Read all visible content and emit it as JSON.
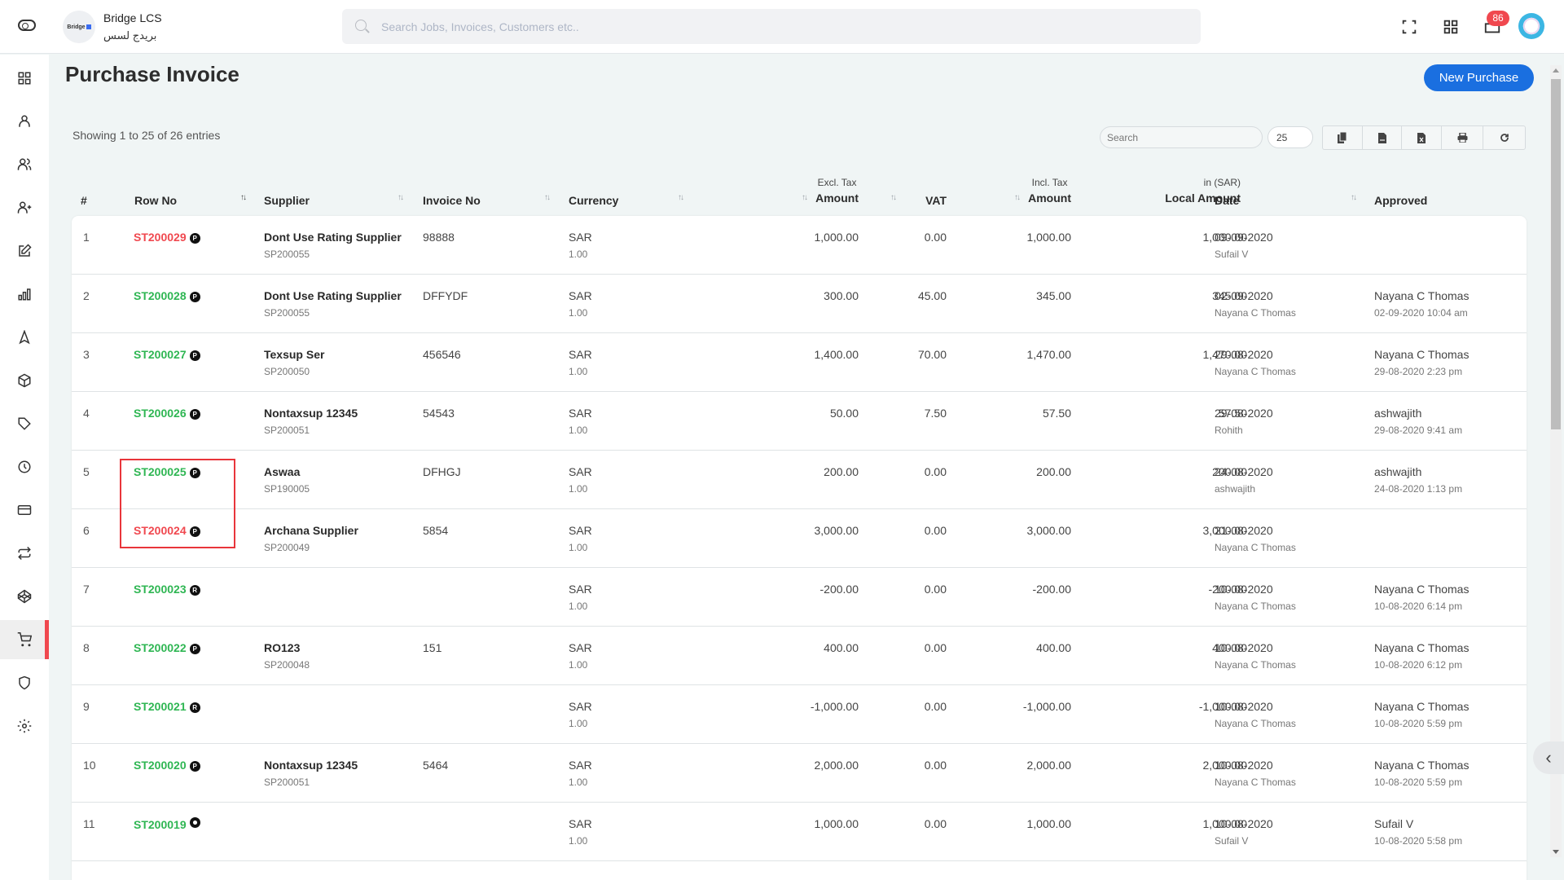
{
  "app": {
    "brand_name": "Bridge LCS",
    "brand_name_ar": "بريدج لسس",
    "logo_text": "Bridge",
    "search_placeholder": "Search Jobs, Invoices, Customers etc..",
    "notification_count": "86",
    "colors": {
      "accent": "#1a6fe0",
      "active": "#f0484f",
      "approved_green": "#2fb653",
      "pending_red": "#f0484f"
    }
  },
  "sidebar": {
    "items": [
      {
        "name": "dashboard",
        "icon": "grid-icon"
      },
      {
        "name": "user",
        "icon": "user-icon"
      },
      {
        "name": "users",
        "icon": "users-icon"
      },
      {
        "name": "add-user",
        "icon": "user-plus-icon"
      },
      {
        "name": "edit",
        "icon": "edit-icon"
      },
      {
        "name": "reports",
        "icon": "bar-chart-icon"
      },
      {
        "name": "navigation",
        "icon": "navigation-icon"
      },
      {
        "name": "packages",
        "icon": "box-icon"
      },
      {
        "name": "tags",
        "icon": "tag-icon"
      },
      {
        "name": "history",
        "icon": "clock-icon"
      },
      {
        "name": "payments",
        "icon": "credit-card-icon"
      },
      {
        "name": "transfers",
        "icon": "repeat-icon"
      },
      {
        "name": "codepen",
        "icon": "codepen-icon"
      },
      {
        "name": "purchase",
        "icon": "cart-icon",
        "active": true
      },
      {
        "name": "security",
        "icon": "shield-icon"
      },
      {
        "name": "settings",
        "icon": "gear-icon"
      }
    ]
  },
  "page": {
    "title": "Purchase Invoice",
    "new_button": "New Purchase",
    "entries_info": "Showing 1 to 25 of 26 entries",
    "table_search_placeholder": "Search",
    "page_size": "25",
    "export_buttons": [
      "copy-icon",
      "csv-icon",
      "excel-icon",
      "print-icon",
      "refresh-icon"
    ]
  },
  "table": {
    "columns": {
      "index": "#",
      "row_no": "Row No",
      "supplier": "Supplier",
      "invoice_no": "Invoice No",
      "currency": "Currency",
      "excl_sup": "Excl. Tax",
      "excl": "Amount",
      "vat": "VAT",
      "incl_sup": "Incl. Tax",
      "incl": "Amount",
      "local_sup": "in (SAR)",
      "local": "Local Amount",
      "date": "Date",
      "approved": "Approved"
    },
    "rows": [
      {
        "idx": "1",
        "row_no": "ST200029",
        "status": "red",
        "badge": "P",
        "supplier": "Dont Use Rating Supplier",
        "supplier_code": "SP200055",
        "invoice_no": "98888",
        "currency": "SAR",
        "rate": "1.00",
        "excl": "1,000.00",
        "vat": "0.00",
        "incl": "1,000.00",
        "local": "1,000.00",
        "date": "09-09-2020",
        "created_by": "Sufail V",
        "approved_by": "",
        "approved_at": ""
      },
      {
        "idx": "2",
        "row_no": "ST200028",
        "status": "green",
        "badge": "P",
        "supplier": "Dont Use Rating Supplier",
        "supplier_code": "SP200055",
        "invoice_no": "DFFYDF",
        "currency": "SAR",
        "rate": "1.00",
        "excl": "300.00",
        "vat": "45.00",
        "incl": "345.00",
        "local": "345.00",
        "date": "02-09-2020",
        "created_by": "Nayana C Thomas",
        "approved_by": "Nayana C Thomas",
        "approved_at": "02-09-2020 10:04 am"
      },
      {
        "idx": "3",
        "row_no": "ST200027",
        "status": "green",
        "badge": "P",
        "supplier": "Texsup Ser",
        "supplier_code": "SP200050",
        "invoice_no": "456546",
        "currency": "SAR",
        "rate": "1.00",
        "excl": "1,400.00",
        "vat": "70.00",
        "incl": "1,470.00",
        "local": "1,470.00",
        "date": "29-08-2020",
        "created_by": "Nayana C Thomas",
        "approved_by": "Nayana C Thomas",
        "approved_at": "29-08-2020 2:23 pm"
      },
      {
        "idx": "4",
        "row_no": "ST200026",
        "status": "green",
        "badge": "P",
        "supplier": "Nontaxsup 12345",
        "supplier_code": "SP200051",
        "invoice_no": "54543",
        "currency": "SAR",
        "rate": "1.00",
        "excl": "50.00",
        "vat": "7.50",
        "incl": "57.50",
        "local": "57.50",
        "date": "29-08-2020",
        "created_by": "Rohith",
        "approved_by": "ashwajith",
        "approved_at": "29-08-2020 9:41 am"
      },
      {
        "idx": "5",
        "row_no": "ST200025",
        "status": "green",
        "badge": "P",
        "supplier": "Aswaa",
        "supplier_code": "SP190005",
        "invoice_no": "DFHGJ",
        "currency": "SAR",
        "rate": "1.00",
        "excl": "200.00",
        "vat": "0.00",
        "incl": "200.00",
        "local": "200.00",
        "date": "24-08-2020",
        "created_by": "ashwajith",
        "approved_by": "ashwajith",
        "approved_at": "24-08-2020 1:13 pm"
      },
      {
        "idx": "6",
        "row_no": "ST200024",
        "status": "red",
        "badge": "P",
        "supplier": "Archana Supplier",
        "supplier_code": "SP200049",
        "invoice_no": "5854",
        "currency": "SAR",
        "rate": "1.00",
        "excl": "3,000.00",
        "vat": "0.00",
        "incl": "3,000.00",
        "local": "3,000.00",
        "date": "21-08-2020",
        "created_by": "Nayana C Thomas",
        "approved_by": "",
        "approved_at": ""
      },
      {
        "idx": "7",
        "row_no": "ST200023",
        "status": "green",
        "badge": "R",
        "supplier": "",
        "supplier_code": "",
        "invoice_no": "",
        "currency": "SAR",
        "rate": "1.00",
        "excl": "-200.00",
        "vat": "0.00",
        "incl": "-200.00",
        "local": "-200.00",
        "date": "10-08-2020",
        "created_by": "Nayana C Thomas",
        "approved_by": "Nayana C Thomas",
        "approved_at": "10-08-2020 6:14 pm"
      },
      {
        "idx": "8",
        "row_no": "ST200022",
        "status": "green",
        "badge": "P",
        "supplier": "RO123",
        "supplier_code": "SP200048",
        "invoice_no": "151",
        "currency": "SAR",
        "rate": "1.00",
        "excl": "400.00",
        "vat": "0.00",
        "incl": "400.00",
        "local": "400.00",
        "date": "10-08-2020",
        "created_by": "Nayana C Thomas",
        "approved_by": "Nayana C Thomas",
        "approved_at": "10-08-2020 6:12 pm"
      },
      {
        "idx": "9",
        "row_no": "ST200021",
        "status": "green",
        "badge": "R",
        "supplier": "",
        "supplier_code": "",
        "invoice_no": "",
        "currency": "SAR",
        "rate": "1.00",
        "excl": "-1,000.00",
        "vat": "0.00",
        "incl": "-1,000.00",
        "local": "-1,000.00",
        "date": "10-08-2020",
        "created_by": "Nayana C Thomas",
        "approved_by": "Nayana C Thomas",
        "approved_at": "10-08-2020 5:59 pm"
      },
      {
        "idx": "10",
        "row_no": "ST200020",
        "status": "green",
        "badge": "P",
        "supplier": "Nontaxsup 12345",
        "supplier_code": "SP200051",
        "invoice_no": "5464",
        "currency": "SAR",
        "rate": "1.00",
        "excl": "2,000.00",
        "vat": "0.00",
        "incl": "2,000.00",
        "local": "2,000.00",
        "date": "10-08-2020",
        "created_by": "Nayana C Thomas",
        "approved_by": "Nayana C Thomas",
        "approved_at": "10-08-2020 5:59 pm"
      },
      {
        "idx": "11",
        "row_no": "ST200019",
        "status": "green",
        "badge": "O",
        "supplier": "",
        "supplier_code": "",
        "invoice_no": "",
        "currency": "SAR",
        "rate": "1.00",
        "excl": "1,000.00",
        "vat": "0.00",
        "incl": "1,000.00",
        "local": "1,000.00",
        "date": "10-08-2020",
        "created_by": "Sufail V",
        "approved_by": "Sufail V",
        "approved_at": "10-08-2020 5:58 pm"
      }
    ]
  }
}
